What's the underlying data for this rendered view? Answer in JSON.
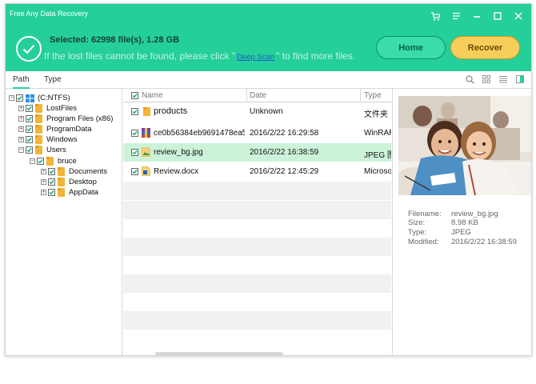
{
  "app": {
    "title": "Free Any Data Recovery",
    "accent": "#25cf9a"
  },
  "header": {
    "selected_text": "Selected: 62998 file(s), 1.28 GB",
    "hint_before": "If the lost files cannot be found, please click \"",
    "hint_link": "Deep Scan",
    "hint_after": "\" to find more files.",
    "home_label": "Home",
    "recover_label": "Recover"
  },
  "tabs": {
    "path": "Path",
    "type": "Type"
  },
  "tree": [
    {
      "label": "(C:NTFS)"
    },
    {
      "label": "LostFiles"
    },
    {
      "label": "Program Files (x86)"
    },
    {
      "label": "ProgramData"
    },
    {
      "label": "Windows"
    },
    {
      "label": "Users"
    },
    {
      "label": "bruce"
    },
    {
      "label": "Documents"
    },
    {
      "label": "Desktop"
    },
    {
      "label": "AppData"
    }
  ],
  "list": {
    "columns": {
      "name": "Name",
      "date": "Date",
      "type": "Type"
    },
    "rows": [
      {
        "name": "products",
        "date": "Unknown",
        "type": "文件夹"
      },
      {
        "name": "ce0b56384eb9691478ea5...",
        "date": "2016/2/22 16:29:58",
        "type": "WinRAR"
      },
      {
        "name": "review_bg.jpg",
        "date": "2016/2/22 16:38:59",
        "type": "JPEG 图"
      },
      {
        "name": "Review.docx",
        "date": "2016/2/22 12:45:29",
        "type": "Microso"
      }
    ]
  },
  "preview": {
    "labels": {
      "filename": "Filename:",
      "size": "Size:",
      "type": "Type:",
      "modified": "Modified:"
    },
    "values": {
      "filename": "review_bg.jpg",
      "size": "8.98 KB",
      "type": "JPEG",
      "modified": "2016/2/22 16:38:59"
    }
  }
}
